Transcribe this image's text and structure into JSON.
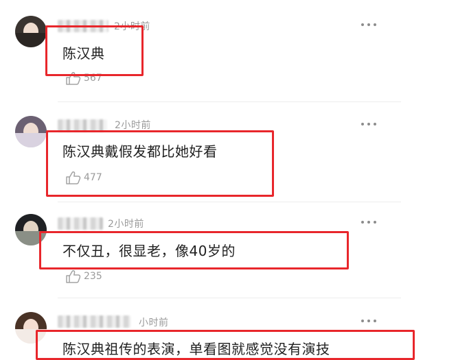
{
  "colors": {
    "highlight_box": "#e8262b",
    "meta_text": "#9a9a9a",
    "body_text": "#1f1f1f"
  },
  "comments": [
    {
      "time": "2小时前",
      "text": "陈汉典",
      "likes": "567"
    },
    {
      "time": "2小时前",
      "text": "陈汉典戴假发都比她好看",
      "likes": "477"
    },
    {
      "time": "2小时前",
      "text": "不仅丑，很显老，像40岁的",
      "likes": "235"
    },
    {
      "time": "小时前",
      "text": "陈汉典祖传的表演，单看图就感觉没有演技"
    }
  ],
  "icons": {
    "more": "more-dots-icon",
    "like": "thumbs-up-icon"
  }
}
